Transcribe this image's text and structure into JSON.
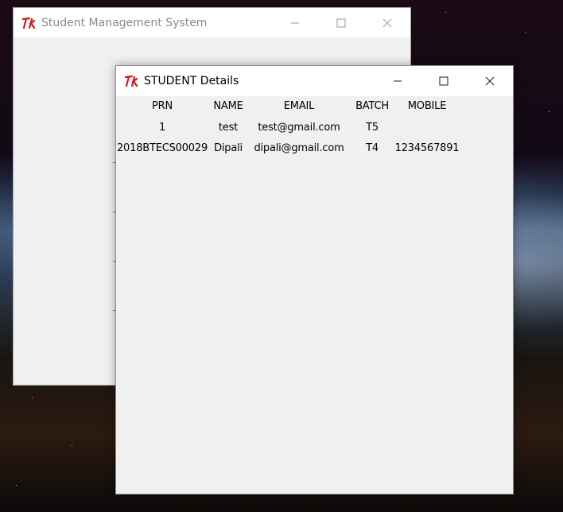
{
  "main_window": {
    "title": "Student Management System",
    "controls": {
      "minimize": "minimize-icon",
      "maximize": "maximize-icon",
      "close": "close-icon"
    }
  },
  "details_window": {
    "title": "STUDENT Details",
    "controls": {
      "minimize": "minimize-icon",
      "maximize": "maximize-icon",
      "close": "close-icon"
    },
    "table": {
      "headers": [
        "PRN",
        "NAME",
        "EMAIL",
        "BATCH",
        "MOBILE"
      ],
      "rows": [
        [
          "1",
          "test",
          "test@gmail.com",
          "T5",
          ""
        ],
        [
          "2018BTECS00029",
          "Dipali",
          "dipali@gmail.com",
          "T4",
          "1234567891"
        ]
      ]
    }
  },
  "colors": {
    "tk_logo": "#d7191c",
    "window_bg": "#f0f0f0",
    "titlebar_bg": "#ffffff"
  }
}
